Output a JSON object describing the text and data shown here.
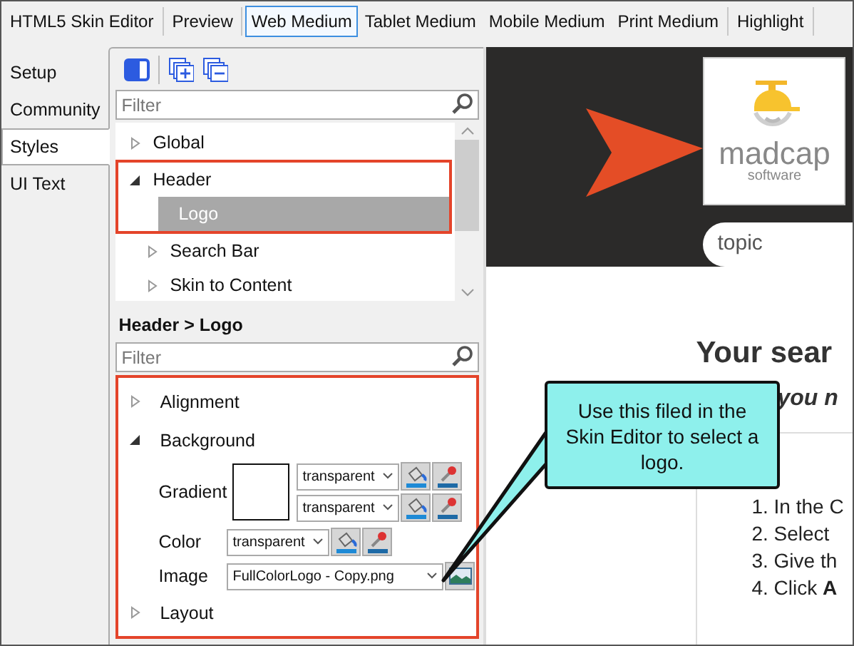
{
  "toolbar": {
    "groups": [
      [
        {
          "label": "HTML5 Skin Editor",
          "selected": false
        }
      ],
      [
        {
          "label": "Preview",
          "selected": false
        }
      ],
      [
        {
          "label": "Web Medium",
          "selected": true
        },
        {
          "label": "Tablet Medium",
          "selected": false
        },
        {
          "label": "Mobile Medium",
          "selected": false
        },
        {
          "label": "Print Medium",
          "selected": false
        }
      ],
      [
        {
          "label": "Highlight",
          "selected": false
        }
      ]
    ]
  },
  "side_tabs": [
    {
      "label": "Setup",
      "selected": false
    },
    {
      "label": "Community",
      "selected": false
    },
    {
      "label": "Styles",
      "selected": true
    },
    {
      "label": "UI Text",
      "selected": false
    }
  ],
  "tree": {
    "filter_placeholder": "Filter",
    "items": [
      {
        "label": "Global",
        "expanded": false,
        "selected": false,
        "highlighted": false
      },
      {
        "label": "Header",
        "expanded": true,
        "selected": false,
        "highlighted": true,
        "children": [
          {
            "label": "Logo",
            "leaf": true,
            "selected": true,
            "highlighted": true
          },
          {
            "label": "Search Bar",
            "expanded": false,
            "selected": false,
            "highlighted": false
          },
          {
            "label": "Skin to Content",
            "expanded": false,
            "selected": false,
            "highlighted": false
          }
        ]
      }
    ]
  },
  "properties": {
    "breadcrumb": "Header > Logo",
    "filter_placeholder": "Filter",
    "highlighted": true,
    "sections": [
      {
        "label": "Alignment",
        "expanded": false
      },
      {
        "label": "Background",
        "expanded": true,
        "fields": [
          {
            "kind": "gradient",
            "label": "Gradient",
            "values": [
              "transparent",
              "transparent"
            ]
          },
          {
            "kind": "color",
            "label": "Color",
            "value": "transparent"
          },
          {
            "kind": "image",
            "label": "Image",
            "value": "FullColorLogo - Copy.png"
          }
        ]
      },
      {
        "label": "Layout",
        "expanded": false
      }
    ]
  },
  "preview": {
    "logo_text": "madcap",
    "logo_subtext": "software",
    "search_value": "topic",
    "heading_line_1": "Your sear",
    "heading_line_2": "you n",
    "steps": [
      "1. In the C",
      "2. Select",
      "3. Give th",
      "4. Click **A**"
    ]
  },
  "callout": {
    "text": "Use this filed in the Skin Editor to select a logo."
  }
}
